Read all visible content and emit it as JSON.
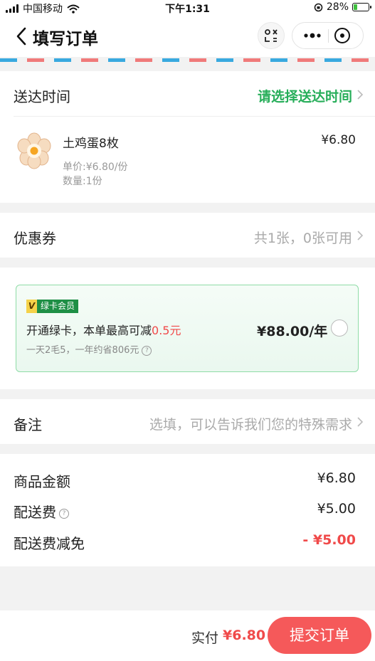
{
  "status": {
    "carrier": "中国移动",
    "time": "下午1:31",
    "battery_pct": "28%",
    "battery_level": 0.28
  },
  "nav": {
    "title": "填写订单"
  },
  "delivery": {
    "label": "送达时间",
    "value": "请选择送达时间"
  },
  "product": {
    "name": "土鸡蛋8枚",
    "price": "¥6.80",
    "unit_price": "单价:¥6.80/份",
    "quantity": "数量:1份"
  },
  "coupon": {
    "label": "优惠券",
    "value": "共1张，0张可用"
  },
  "promo": {
    "badge_v": "V",
    "badge_text": "绿卡会员",
    "title_prefix": "开通绿卡，本单最高可减",
    "title_amount": "0.5元",
    "subtitle": "一天2毛5，一年约省806元",
    "price": "¥88.00/年"
  },
  "remark": {
    "label": "备注",
    "placeholder": "选填，可以告诉我们您的特殊需求"
  },
  "summary": {
    "goods_label": "商品金额",
    "goods_value": "¥6.80",
    "delivery_label": "配送费",
    "delivery_value": "¥5.00",
    "discount_label": "配送费减免",
    "discount_value": "- ¥5.00"
  },
  "footer": {
    "pay_label": "实付",
    "pay_amount": "¥6.80",
    "submit_label": "提交订单"
  },
  "colors": {
    "accent_green": "#27ae5a",
    "accent_red": "#f04a4a",
    "submit_bg": "#f5595a"
  }
}
